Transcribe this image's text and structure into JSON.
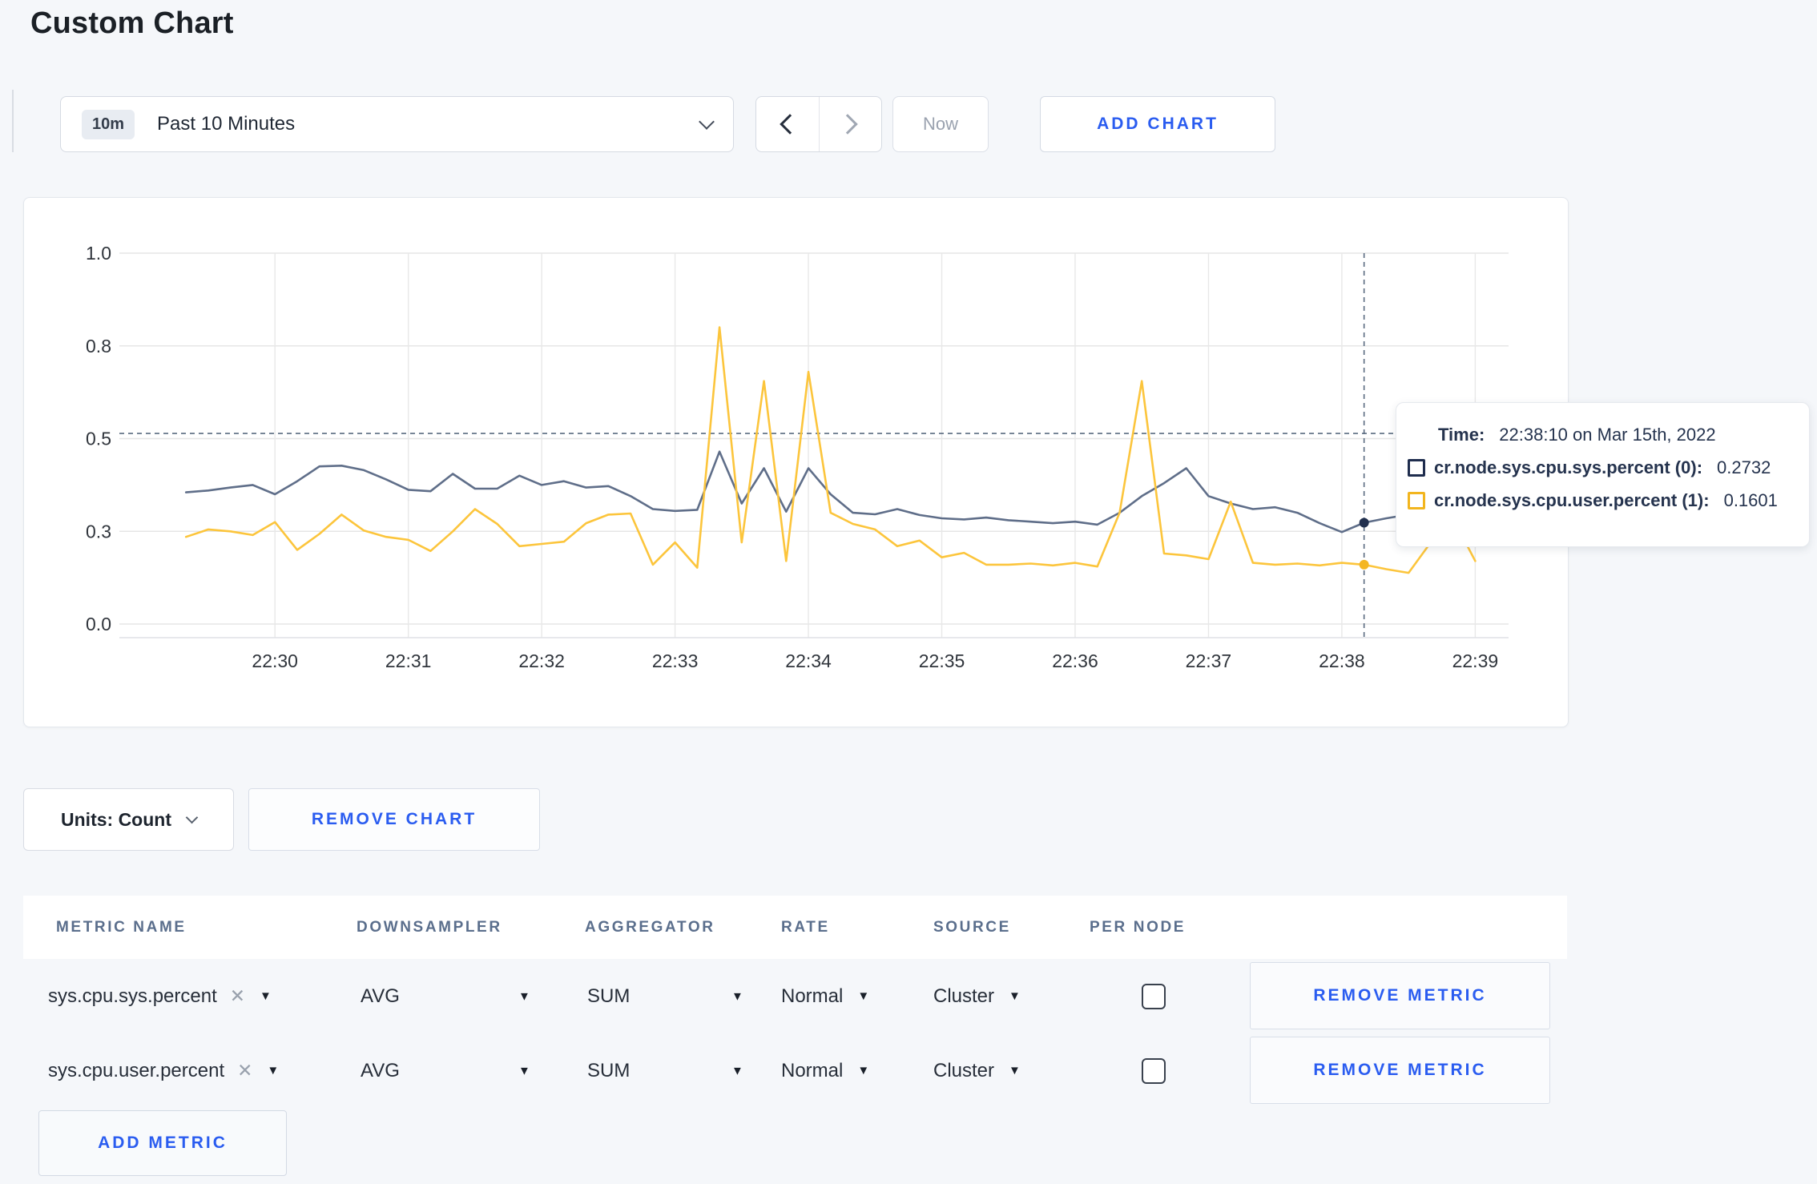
{
  "page": {
    "title": "Custom Chart"
  },
  "toolbar": {
    "timeframe": {
      "badge": "10m",
      "label": "Past 10 Minutes"
    },
    "prev_icon": "chevron-left",
    "next_icon": "chevron-right",
    "now_label": "Now",
    "add_chart_label": "ADD CHART"
  },
  "chart_data": {
    "type": "line",
    "title": "",
    "xlabel": "",
    "ylabel": "",
    "grid": true,
    "legend_position": "hover-tooltip",
    "x_axis": {
      "domain_seconds": [
        0,
        625
      ],
      "start_time_label": "22:29:20",
      "start_offset_seconds": 30,
      "step_seconds": 10,
      "ticks": [
        {
          "t": 70,
          "label": "22:30"
        },
        {
          "t": 130,
          "label": "22:31"
        },
        {
          "t": 190,
          "label": "22:32"
        },
        {
          "t": 250,
          "label": "22:33"
        },
        {
          "t": 310,
          "label": "22:34"
        },
        {
          "t": 370,
          "label": "22:35"
        },
        {
          "t": 430,
          "label": "22:36"
        },
        {
          "t": 490,
          "label": "22:37"
        },
        {
          "t": 550,
          "label": "22:38"
        },
        {
          "t": 610,
          "label": "22:39"
        }
      ]
    },
    "y_axis": {
      "range": [
        0,
        1
      ],
      "ticks": [
        {
          "v": 0,
          "label": "0.0"
        },
        {
          "v": 0.25,
          "label": "0.3"
        },
        {
          "v": 0.5,
          "label": "0.5"
        },
        {
          "v": 0.75,
          "label": "0.8"
        },
        {
          "v": 1,
          "label": "1.0"
        }
      ]
    },
    "series": [
      {
        "name": "cr.node.sys.cpu.sys.percent",
        "color": "#5f6e89",
        "values": [
          0.355,
          0.36,
          0.368,
          0.375,
          0.35,
          0.385,
          0.425,
          0.427,
          0.415,
          0.39,
          0.362,
          0.358,
          0.405,
          0.365,
          0.365,
          0.4,
          0.375,
          0.385,
          0.368,
          0.372,
          0.345,
          0.31,
          0.305,
          0.308,
          0.465,
          0.325,
          0.42,
          0.303,
          0.42,
          0.35,
          0.3,
          0.296,
          0.31,
          0.294,
          0.285,
          0.282,
          0.287,
          0.28,
          0.276,
          0.272,
          0.276,
          0.268,
          0.3,
          0.345,
          0.38,
          0.42,
          0.345,
          0.325,
          0.31,
          0.315,
          0.3,
          0.272,
          0.248,
          0.2732,
          0.285,
          0.295,
          0.3,
          0.305,
          0.3
        ]
      },
      {
        "name": "cr.node.sys.cpu.user.percent",
        "color": "#fcc53c",
        "values": [
          0.235,
          0.255,
          0.25,
          0.24,
          0.275,
          0.2,
          0.243,
          0.295,
          0.252,
          0.235,
          0.227,
          0.197,
          0.25,
          0.31,
          0.27,
          0.21,
          0.216,
          0.222,
          0.272,
          0.295,
          0.298,
          0.16,
          0.22,
          0.152,
          0.8,
          0.22,
          0.655,
          0.17,
          0.68,
          0.3,
          0.27,
          0.255,
          0.21,
          0.225,
          0.18,
          0.192,
          0.16,
          0.16,
          0.163,
          0.158,
          0.165,
          0.155,
          0.3,
          0.655,
          0.19,
          0.185,
          0.175,
          0.33,
          0.165,
          0.16,
          0.163,
          0.158,
          0.165,
          0.1601,
          0.148,
          0.138,
          0.22,
          0.285,
          0.17
        ]
      }
    ],
    "crosshair": {
      "t_seconds": 560,
      "time_label": "22:38:10",
      "h_value": 0.514,
      "markers": [
        {
          "series": 0,
          "value": 0.2732,
          "color": "#22304f"
        },
        {
          "series": 1,
          "value": 0.1601,
          "color": "#f4b623"
        }
      ]
    }
  },
  "tooltip": {
    "time_label": "Time:",
    "time_value": "22:38:10 on Mar 15th, 2022",
    "rows": [
      {
        "name": "cr.node.sys.cpu.sys.percent (0):",
        "value": "0.2732",
        "color": "#1f2d4e"
      },
      {
        "name": "cr.node.sys.cpu.user.percent (1):",
        "value": "0.1601",
        "color": "#f2b51e"
      }
    ]
  },
  "chart_controls": {
    "units_label": "Units: Count",
    "remove_chart_label": "REMOVE CHART"
  },
  "metrics_table": {
    "headers": [
      "METRIC NAME",
      "DOWNSAMPLER",
      "AGGREGATOR",
      "RATE",
      "SOURCE",
      "PER NODE"
    ],
    "rows": [
      {
        "name": "sys.cpu.sys.percent",
        "remove_icon": "✕",
        "downsampler": "AVG",
        "aggregator": "SUM",
        "rate": "Normal",
        "source": "Cluster",
        "per_node_checked": false,
        "remove_label": "REMOVE METRIC"
      },
      {
        "name": "sys.cpu.user.percent",
        "remove_icon": "✕",
        "downsampler": "AVG",
        "aggregator": "SUM",
        "rate": "Normal",
        "source": "Cluster",
        "per_node_checked": false,
        "remove_label": "REMOVE METRIC"
      }
    ],
    "add_metric_label": "ADD METRIC",
    "caret_icon": "▼"
  }
}
